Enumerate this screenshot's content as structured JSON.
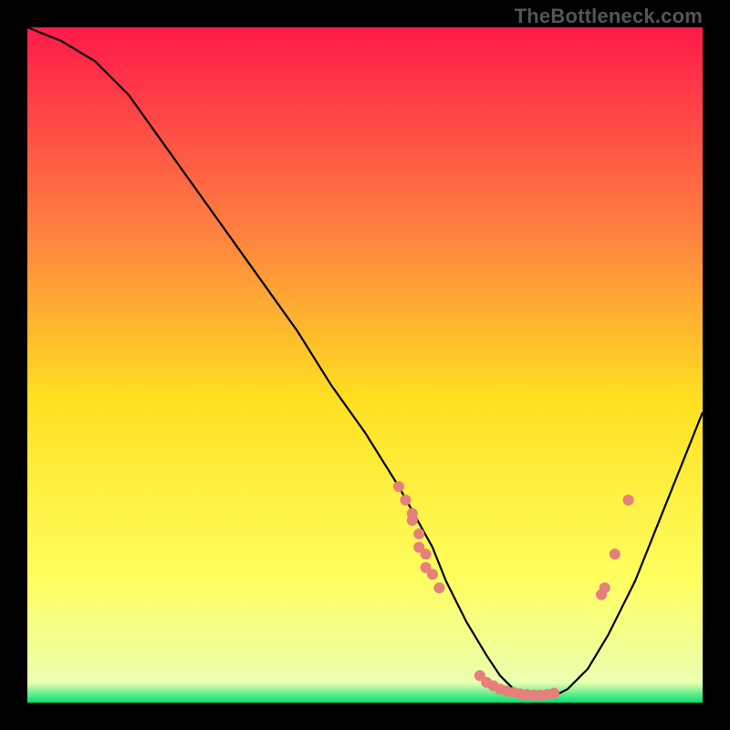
{
  "watermark": "TheBottleneck.com",
  "chart_data": {
    "type": "line",
    "title": "",
    "xlabel": "",
    "ylabel": "",
    "xlim": [
      0,
      100
    ],
    "ylim": [
      0,
      100
    ],
    "grid": false,
    "legend": false,
    "background_gradient": {
      "top": "#ff1a4a",
      "mid1": "#ff8040",
      "mid2": "#ffe020",
      "mid3": "#ffff60",
      "bottom": "#00e070"
    },
    "curve": {
      "name": "bottleneck-curve",
      "color": "#000000",
      "x": [
        0,
        5,
        10,
        15,
        20,
        25,
        30,
        35,
        40,
        45,
        50,
        55,
        60,
        62,
        65,
        68,
        70,
        72,
        75,
        78,
        80,
        83,
        86,
        90,
        94,
        98,
        100
      ],
      "y": [
        100,
        98,
        95,
        90,
        83,
        76,
        69,
        62,
        55,
        47,
        40,
        32,
        23,
        18,
        12,
        7,
        4,
        2,
        1,
        1,
        2,
        5,
        10,
        18,
        28,
        38,
        43
      ]
    },
    "scatter": {
      "name": "data-points",
      "color": "#e77f7a",
      "radius": 6,
      "points": [
        {
          "x": 55,
          "y": 32
        },
        {
          "x": 56,
          "y": 30
        },
        {
          "x": 57,
          "y": 28
        },
        {
          "x": 57,
          "y": 27
        },
        {
          "x": 58,
          "y": 25
        },
        {
          "x": 58,
          "y": 23
        },
        {
          "x": 59,
          "y": 22
        },
        {
          "x": 59,
          "y": 20
        },
        {
          "x": 60,
          "y": 19
        },
        {
          "x": 61,
          "y": 17
        },
        {
          "x": 67,
          "y": 4
        },
        {
          "x": 68,
          "y": 3
        },
        {
          "x": 69,
          "y": 2.5
        },
        {
          "x": 70,
          "y": 2
        },
        {
          "x": 71,
          "y": 1.7
        },
        {
          "x": 72,
          "y": 1.5
        },
        {
          "x": 73,
          "y": 1.3
        },
        {
          "x": 74,
          "y": 1.2
        },
        {
          "x": 75,
          "y": 1.1
        },
        {
          "x": 76,
          "y": 1.1
        },
        {
          "x": 77,
          "y": 1.2
        },
        {
          "x": 78,
          "y": 1.4
        },
        {
          "x": 85,
          "y": 16
        },
        {
          "x": 85.5,
          "y": 17
        },
        {
          "x": 87,
          "y": 22
        },
        {
          "x": 89,
          "y": 30
        }
      ]
    }
  }
}
